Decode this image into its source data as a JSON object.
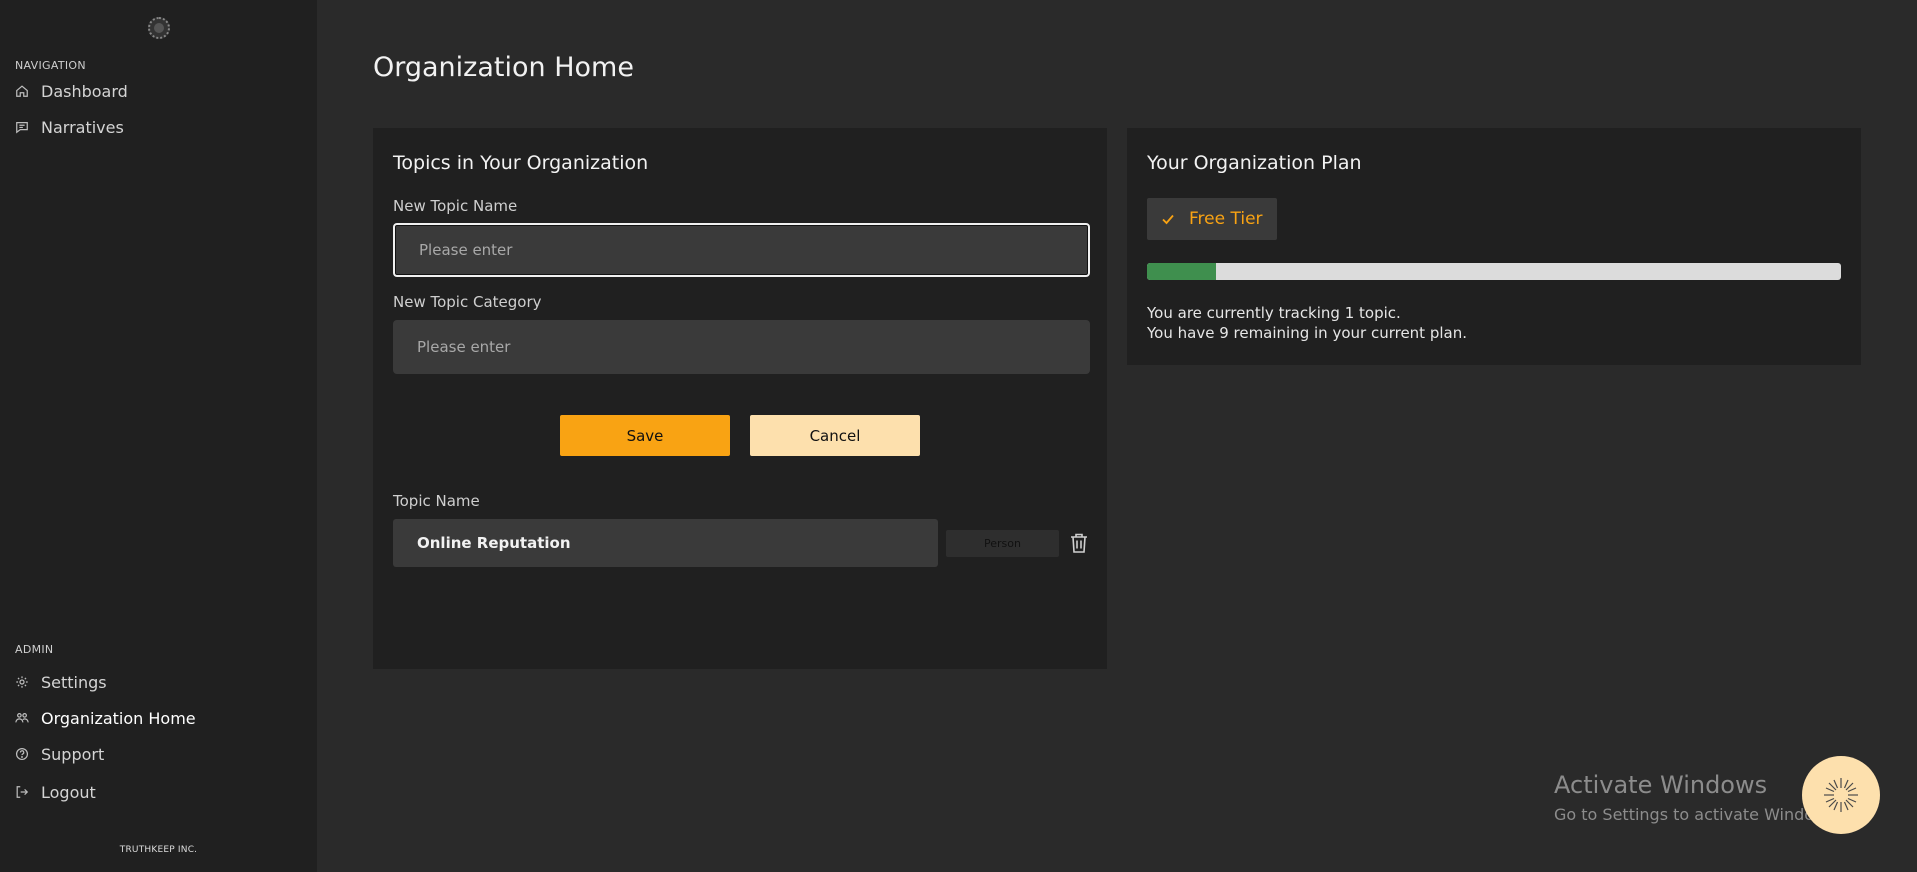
{
  "sidebar": {
    "navigation_label": "NAVIGATION",
    "nav_items": [
      {
        "label": "Dashboard",
        "icon": "home-icon"
      },
      {
        "label": "Narratives",
        "icon": "message-icon"
      }
    ],
    "admin_label": "ADMIN",
    "admin_items": [
      {
        "label": "Settings",
        "icon": "gear-icon"
      },
      {
        "label": "Organization Home",
        "icon": "users-icon",
        "active": true
      },
      {
        "label": "Support",
        "icon": "help-circle-icon"
      },
      {
        "label": "Logout",
        "icon": "logout-icon"
      }
    ],
    "company": "TRUTHKEEP INC."
  },
  "page": {
    "title": "Organization Home"
  },
  "topics_card": {
    "title": "Topics in Your Organization",
    "new_topic_name_label": "New Topic Name",
    "new_topic_name_placeholder": "Please enter",
    "new_topic_category_label": "New Topic Category",
    "new_topic_category_placeholder": "Please enter",
    "save_label": "Save",
    "cancel_label": "Cancel",
    "topic_name_header": "Topic Name",
    "topics": [
      {
        "name": "Online Reputation",
        "category": "Person"
      }
    ]
  },
  "plan_card": {
    "title": "Your Organization Plan",
    "tier_label": "Free Tier",
    "usage_fraction": 0.1,
    "tracking_text": "You are currently tracking 1 topic.",
    "remaining_text": "You have 9 remaining in your current plan."
  },
  "watermark": {
    "title": "Activate Windows",
    "subtitle": "Go to Settings to activate Windows."
  },
  "colors": {
    "accent": "#f9a313",
    "accent_light": "#fde0ad",
    "progress": "#3f8f4e",
    "sidebar_bg": "#202020",
    "page_bg": "#2a2a2a"
  }
}
